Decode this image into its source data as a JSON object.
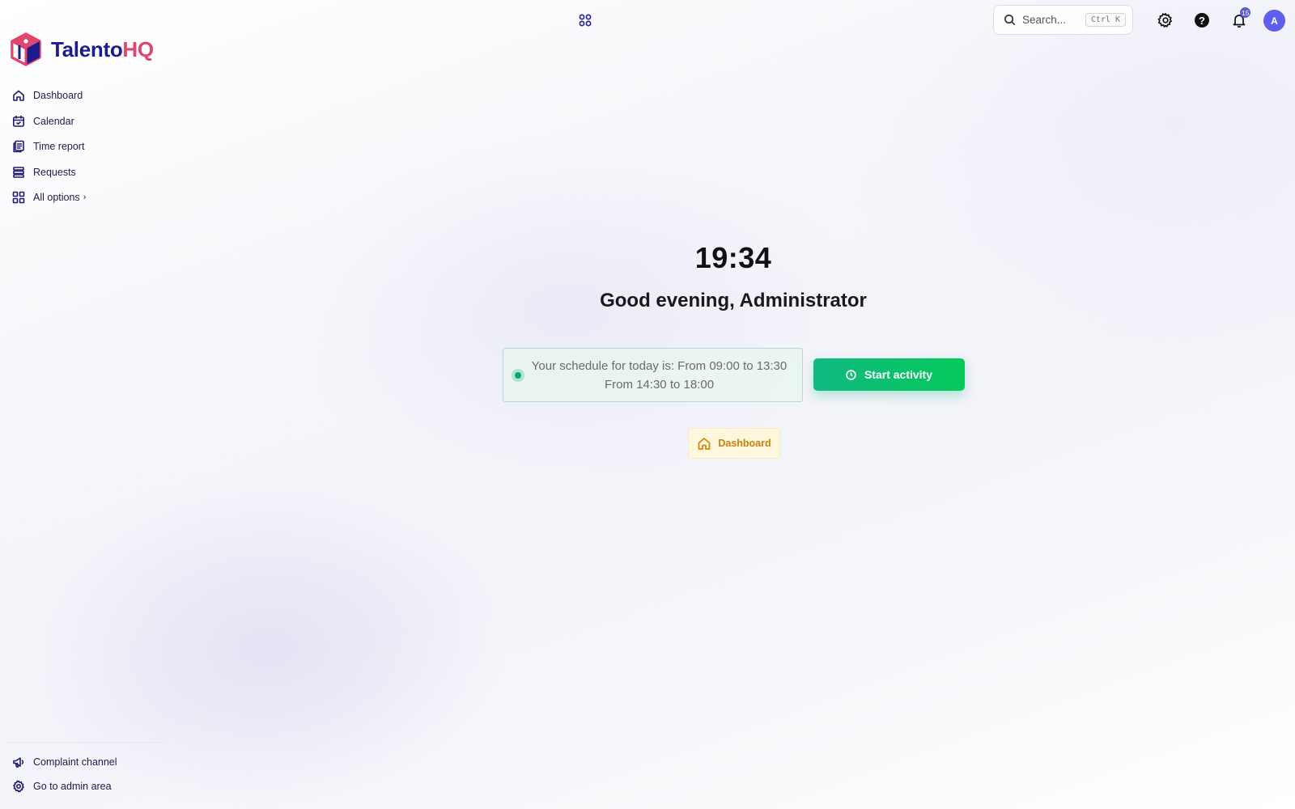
{
  "brand": {
    "name_part1": "Talento",
    "name_part2": "HQ",
    "logo_icon": "cube-logo-icon"
  },
  "sidebar": {
    "items": [
      {
        "label": "Dashboard",
        "icon": "home-icon"
      },
      {
        "label": "Calendar",
        "icon": "calendar-icon"
      },
      {
        "label": "Time report",
        "icon": "report-icon"
      },
      {
        "label": "Requests",
        "icon": "list-icon"
      }
    ],
    "all_options": {
      "label": "All options",
      "icon": "grid-icon"
    },
    "bottom": [
      {
        "label": "Complaint channel",
        "icon": "megaphone-icon"
      },
      {
        "label": "Go to admin area",
        "icon": "gear-icon"
      }
    ]
  },
  "topbar": {
    "search": {
      "placeholder": "Search...",
      "shortcut": "Ctrl K"
    },
    "notifications_count": "15",
    "avatar_initial": "A"
  },
  "main": {
    "time": "19:34",
    "greeting": "Good evening, Administrator",
    "schedule": {
      "line1": "Your schedule for today is: From 09:00 to 13:30",
      "line2": "From 14:30 to 18:00"
    },
    "start_button": "Start activity",
    "dashboard_chip": "Dashboard"
  },
  "colors": {
    "brand_dark": "#1e1b8e",
    "brand_accent": "#e0456f",
    "primary_green": "#10b981",
    "chip_orange": "#d28a0a",
    "avatar": "#5d5fef"
  }
}
